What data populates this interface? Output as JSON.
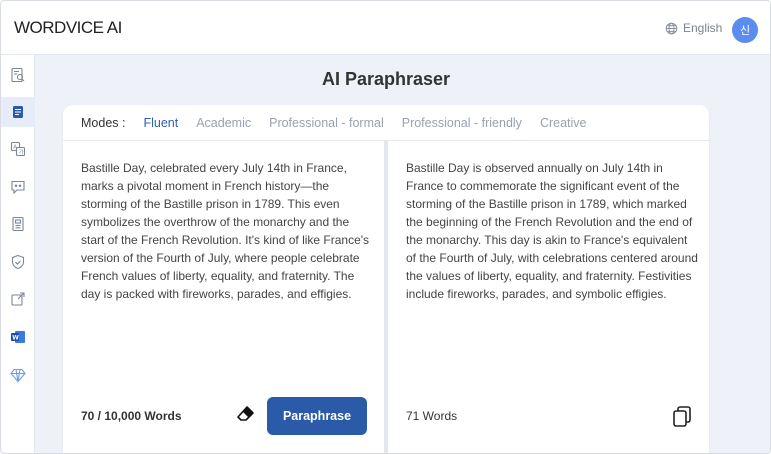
{
  "header": {
    "logo_bold": "WORDVICE",
    "logo_rest": " AI",
    "language": "English",
    "avatar_initial": "신"
  },
  "sidebar": {
    "items": [
      {
        "icon": "document-search-icon"
      },
      {
        "icon": "paraphraser-icon",
        "active": true
      },
      {
        "icon": "translate-icon"
      },
      {
        "icon": "chat-icon"
      },
      {
        "icon": "summary-icon"
      },
      {
        "icon": "plagiarism-shield-icon"
      },
      {
        "icon": "external-link-icon"
      },
      {
        "icon": "word-addin-icon"
      },
      {
        "icon": "diamond-icon"
      }
    ]
  },
  "page": {
    "title": "AI Paraphraser"
  },
  "modes": {
    "label": "Modes :",
    "items": [
      "Fluent",
      "Academic",
      "Professional - formal",
      "Professional - friendly",
      "Creative"
    ],
    "active": "Fluent"
  },
  "input": {
    "text": "Bastille Day, celebrated every July 14th in France, marks a pivotal moment in French history—the storming of the Bastille prison in 1789. This even symbolizes the overthrow of the monarchy and the start of the French Revolution. It's kind of like France's version of the Fourth of July, where people celebrate French values of liberty, equality, and fraternity. The day is packed with fireworks, parades, and effigies.",
    "word_count": "70 / 10,000 Words",
    "button_label": "Paraphrase"
  },
  "output": {
    "text": "Bastille Day is observed annually on July 14th in France to commemorate the significant event of the storming of the Bastille prison in 1789, which marked the beginning of the French Revolution and the end of the monarchy. This day is akin to France's equivalent of the Fourth of July, with celebrations centered around the values of liberty, equality, and fraternity. Festivities include fireworks, parades, and symbolic effigies.",
    "word_count": "71 Words"
  },
  "colors": {
    "accent": "#2a5aa8",
    "active_mode": "#2f5fb3",
    "avatar": "#5b8df0",
    "background": "#eef2f8"
  }
}
